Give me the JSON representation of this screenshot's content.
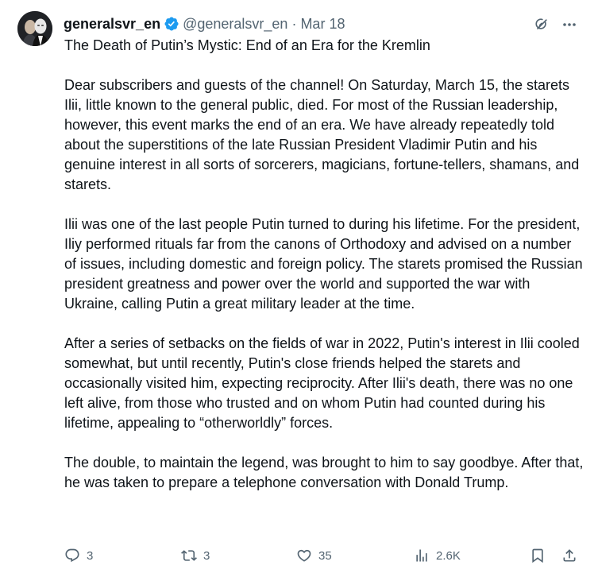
{
  "author": {
    "display_name": "generalsvr_en",
    "handle": "@generalsvr_en",
    "separator": "·",
    "date": "Mar 18",
    "verified": true,
    "verified_color": "#1d9bf0"
  },
  "post": {
    "title": "The Death of Putin’s Mystic: End of an Era for the Kremlin",
    "paragraphs": [
      "Dear subscribers and guests of the channel! On Saturday, March 15, the starets Ilii, little known to the general public, died. For most of the Russian leadership, however, this event marks the end of an era. We have already repeatedly told about the superstitions of the late Russian President Vladimir Putin and his genuine interest in all sorts of sorcerers, magicians, fortune-tellers, shamans, and starets.",
      "Ilii was one of the last people Putin turned to during his lifetime. For the president, Iliy performed rituals far from the canons of Orthodoxy and advised on a number of issues, including domestic and foreign policy. The starets promised the Russian president greatness and power over the world and supported the war with Ukraine, calling Putin a great military leader at the time.",
      "After a series of setbacks on the fields of war in 2022, Putin's interest in Ilii cooled somewhat, but until recently, Putin's close friends helped the starets and occasionally visited him, expecting reciprocity. After Ilii's death, there was no one left alive, from those who trusted and on whom Putin had counted during his lifetime, appealing to “otherworldly” forces.",
      "The double, to maintain the legend, was brought to him to say goodbye. After that, he was taken to prepare a telephone conversation with Donald Trump."
    ]
  },
  "actions": {
    "replies": "3",
    "reposts": "3",
    "likes": "35",
    "views": "2.6K"
  },
  "icons": {
    "reply": "reply-icon",
    "repost": "repost-icon",
    "like": "heart-icon",
    "views": "analytics-icon",
    "bookmark": "bookmark-icon",
    "share": "share-icon",
    "grok": "grok-icon",
    "more": "more-icon"
  },
  "colors": {
    "text": "#0f1419",
    "secondary": "#536471",
    "accent": "#1d9bf0"
  }
}
